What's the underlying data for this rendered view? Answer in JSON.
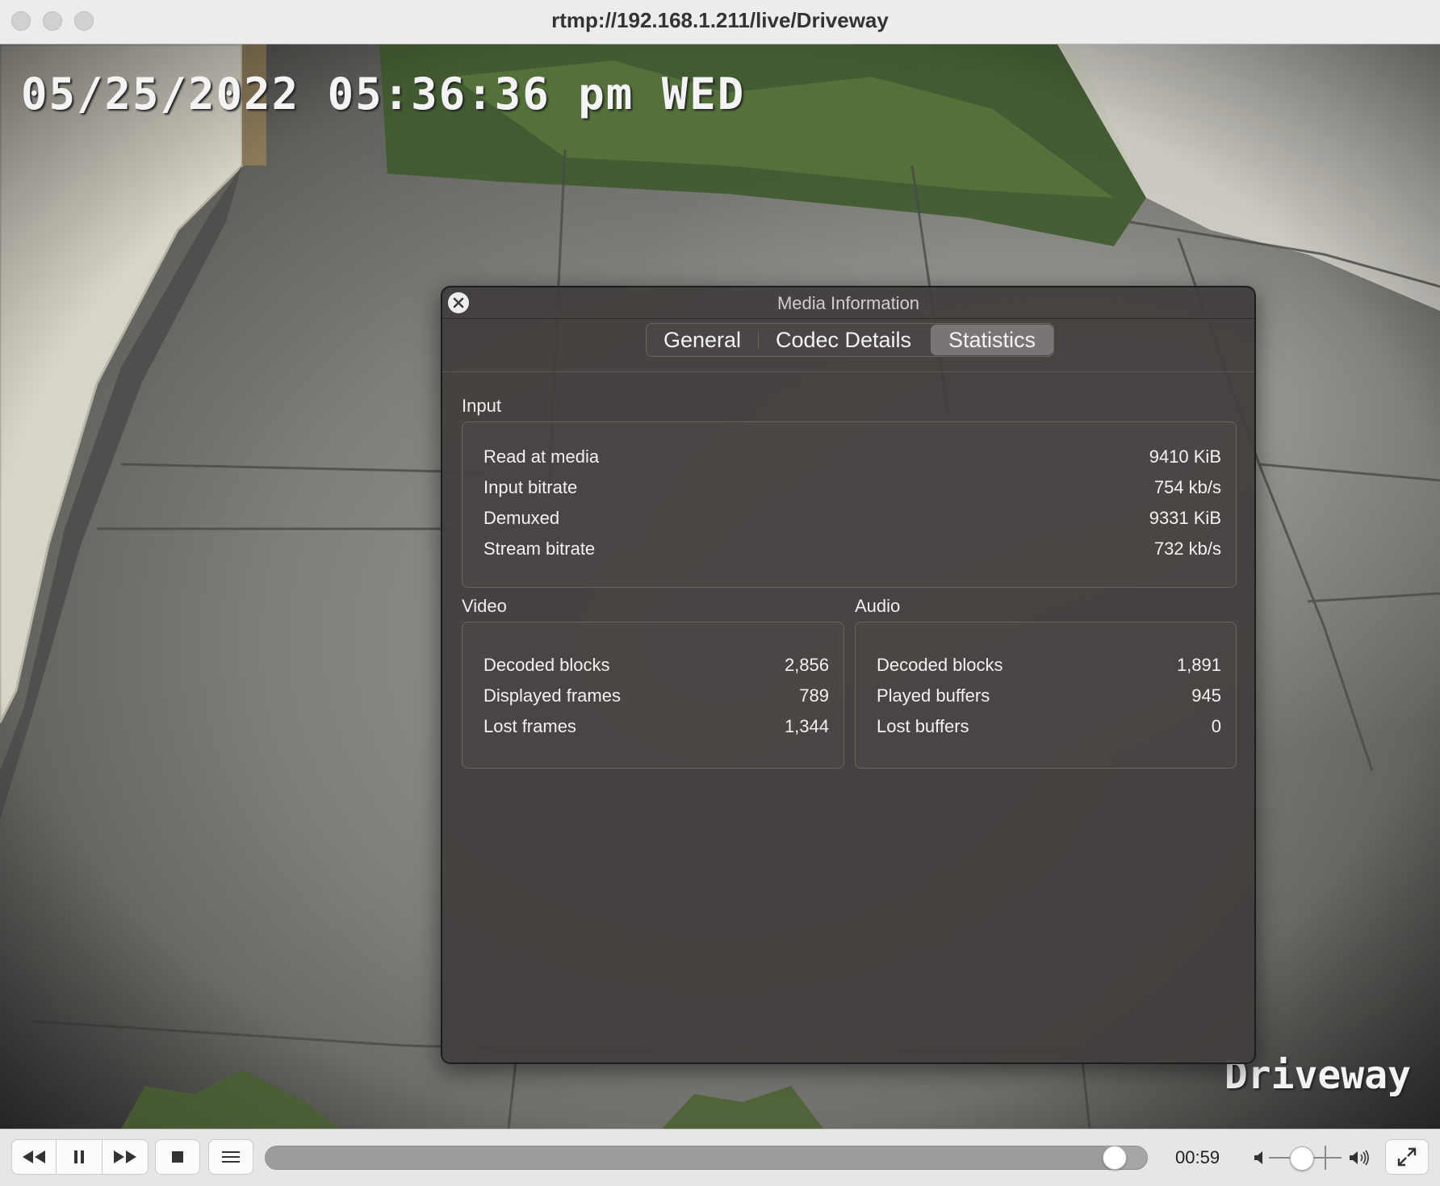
{
  "window": {
    "title": "rtmp://192.168.1.211/live/Driveway"
  },
  "video": {
    "osd_timestamp": "05/25/2022 05:36:36 pm WED",
    "osd_camera_name": "Driveway"
  },
  "media_info": {
    "title": "Media Information",
    "tabs": [
      "General",
      "Codec Details",
      "Statistics"
    ],
    "active_tab": "Statistics",
    "input": {
      "label": "Input",
      "rows": [
        {
          "label": "Read at media",
          "value": "9410 KiB"
        },
        {
          "label": "Input bitrate",
          "value": "754 kb/s"
        },
        {
          "label": "Demuxed",
          "value": "9331 KiB"
        },
        {
          "label": "Stream bitrate",
          "value": "732 kb/s"
        }
      ]
    },
    "video": {
      "label": "Video",
      "rows": [
        {
          "label": "Decoded blocks",
          "value": "2,856"
        },
        {
          "label": "Displayed frames",
          "value": "789"
        },
        {
          "label": "Lost frames",
          "value": "1,344"
        }
      ]
    },
    "audio": {
      "label": "Audio",
      "rows": [
        {
          "label": "Decoded blocks",
          "value": "1,891"
        },
        {
          "label": "Played buffers",
          "value": "945"
        },
        {
          "label": "Lost buffers",
          "value": "0"
        }
      ]
    }
  },
  "controls": {
    "elapsed_time": "00:59",
    "seek_progress": 0.975,
    "volume_level": 0.45
  }
}
